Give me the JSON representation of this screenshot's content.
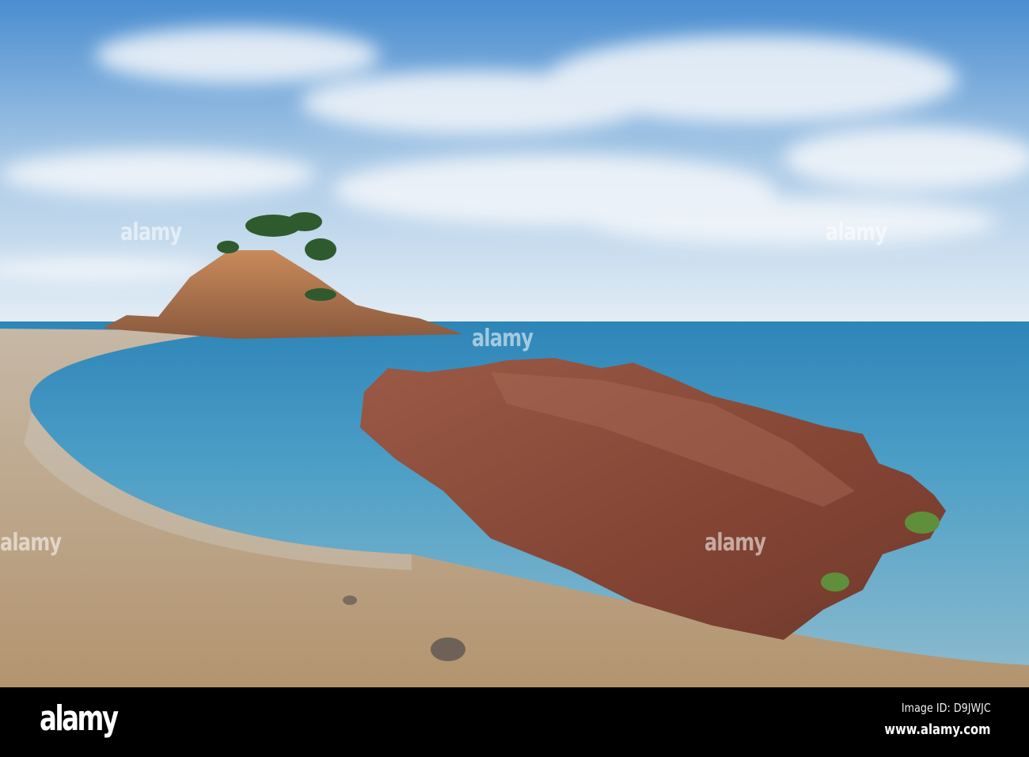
{
  "watermark": {
    "text": "alamy"
  },
  "footer": {
    "logo": "alamy",
    "image_id": "Image ID: D9JWJC",
    "url": "www.alamy.com"
  },
  "colors": {
    "sky_top": "#4f8fd0",
    "sky_horizon": "#dbe8f2",
    "sea": "#4a9fc4",
    "sand": "#c2a88a",
    "rock": "#8a4a38"
  }
}
